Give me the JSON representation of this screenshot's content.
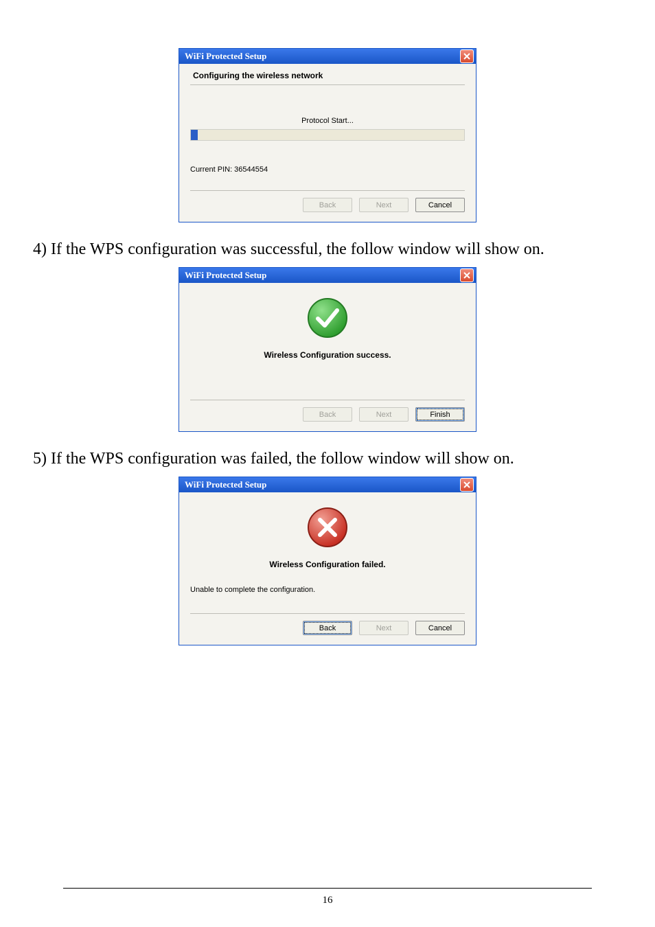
{
  "dialog1": {
    "title": "WiFi Protected Setup",
    "heading": "Configuring the wireless network",
    "status": "Protocol Start...",
    "pin_label": "Current PIN: 36544554",
    "buttons": {
      "back": "Back",
      "next": "Next",
      "cancel": "Cancel"
    }
  },
  "caption1": "4) If the WPS configuration was successful, the follow window will show on.",
  "dialog2": {
    "title": "WiFi Protected Setup",
    "result": "Wireless Configuration success.",
    "buttons": {
      "back": "Back",
      "next": "Next",
      "finish": "Finish"
    }
  },
  "caption2": "5) If the WPS configuration was failed, the follow window will show on.",
  "dialog3": {
    "title": "WiFi Protected Setup",
    "result": "Wireless Configuration failed.",
    "sub": "Unable to complete the configuration.",
    "buttons": {
      "back": "Back",
      "next": "Next",
      "cancel": "Cancel"
    }
  },
  "page_number": "16"
}
